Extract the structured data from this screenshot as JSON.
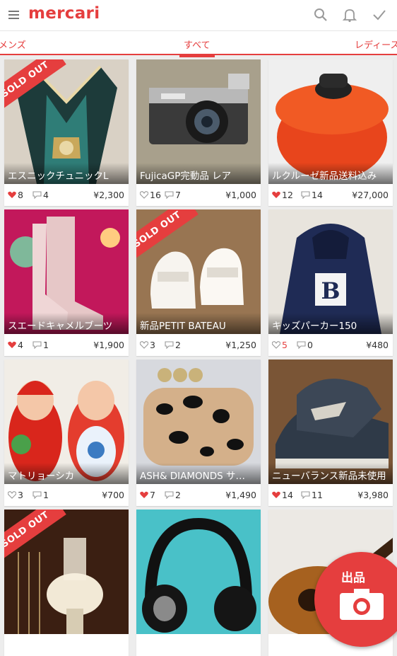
{
  "app": {
    "logo": "mercari",
    "brand_color": "#e53e3e"
  },
  "toolbar": {
    "icons": [
      "menu-icon",
      "search-icon",
      "bell-icon",
      "check-icon"
    ]
  },
  "tabs": [
    {
      "label": "メンズ",
      "active": false
    },
    {
      "label": "すべて",
      "active": true
    },
    {
      "label": "レディース",
      "active": false
    }
  ],
  "soldout_label": "SOLD OUT",
  "items": [
    {
      "title": "エスニックチュニックL",
      "likes": "8",
      "comments": "4",
      "price": "¥2,300",
      "liked": true,
      "sold": true
    },
    {
      "title": "FujicaGP完動品 レア",
      "likes": "16",
      "comments": "7",
      "price": "¥1,000",
      "liked": false,
      "sold": false
    },
    {
      "title": "ルクルーゼ新品送料込み",
      "likes": "12",
      "comments": "14",
      "price": "¥27,000",
      "liked": true,
      "sold": false
    },
    {
      "title": "スエードキャメルブーツ",
      "likes": "4",
      "comments": "1",
      "price": "¥1,900",
      "liked": true,
      "sold": false
    },
    {
      "title": "新品PETIT BATEAU",
      "likes": "3",
      "comments": "2",
      "price": "¥1,250",
      "liked": false,
      "sold": true
    },
    {
      "title": "キッズパーカー150",
      "likes": "5",
      "comments": "0",
      "price": "¥480",
      "liked": false,
      "sold": false
    },
    {
      "title": "マトリョーシカ",
      "likes": "3",
      "comments": "1",
      "price": "¥700",
      "liked": false,
      "sold": false
    },
    {
      "title": "ASH& DIAMONDS サ…",
      "likes": "7",
      "comments": "2",
      "price": "¥1,490",
      "liked": true,
      "sold": false
    },
    {
      "title": "ニューバランス新品未使用",
      "likes": "14",
      "comments": "11",
      "price": "¥3,980",
      "liked": true,
      "sold": false
    },
    {
      "title": "",
      "likes": "",
      "comments": "",
      "price": "",
      "liked": false,
      "sold": true
    },
    {
      "title": "",
      "likes": "",
      "comments": "",
      "price": "",
      "liked": false,
      "sold": false
    },
    {
      "title": "",
      "likes": "",
      "comments": "",
      "price": "",
      "liked": false,
      "sold": false
    }
  ],
  "fab": {
    "label": "出品",
    "icon": "camera-icon"
  }
}
